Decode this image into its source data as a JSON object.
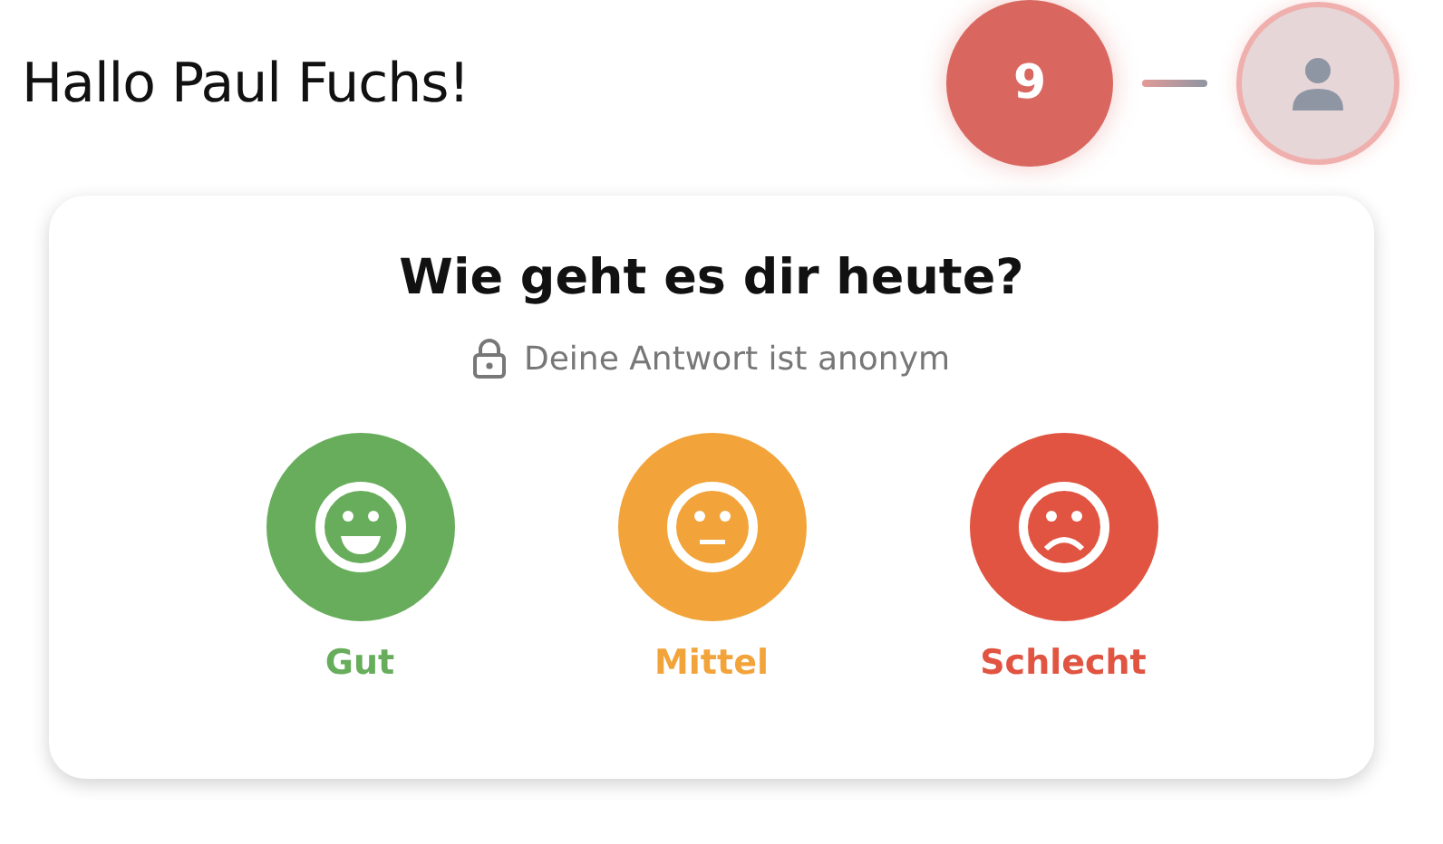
{
  "greeting": "Hallo Paul Fuchs!",
  "notification_count": "9",
  "card": {
    "title": "Wie geht es dir heute?",
    "subtitle": "Deine Antwort ist anonym",
    "options": [
      {
        "label": "Gut",
        "kind": "happy",
        "color": "#67ad5b"
      },
      {
        "label": "Mittel",
        "kind": "neutral",
        "color": "#f2a43b"
      },
      {
        "label": "Schlecht",
        "kind": "sad",
        "color": "#e05441"
      }
    ]
  }
}
